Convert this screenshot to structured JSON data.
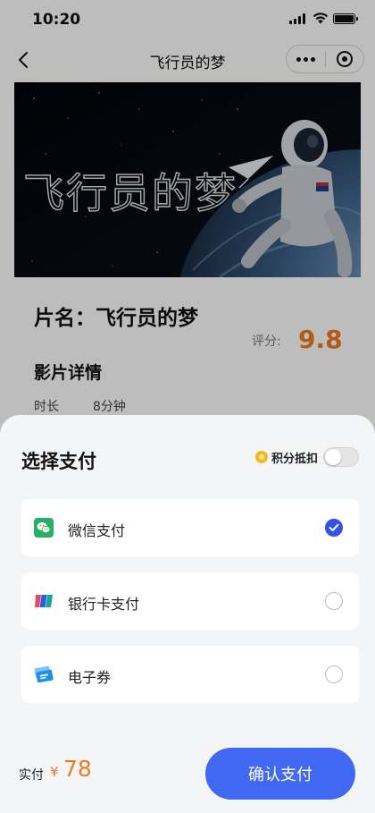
{
  "status_bar": {
    "time": "10:20"
  },
  "nav": {
    "title": "飞行员的梦"
  },
  "poster": {
    "title_art": "飞行员的梦"
  },
  "movie": {
    "name_line": "片名：飞行员的梦",
    "score_label": "评分:",
    "score": "9.8",
    "details_heading": "影片详情",
    "duration_label": "时长",
    "duration_value": "8分钟"
  },
  "payment_sheet": {
    "title": "选择支付",
    "points_label": "积分抵扣",
    "points_enabled": false,
    "options": [
      {
        "label": "微信支付",
        "icon": "wechat-pay-icon",
        "selected": true
      },
      {
        "label": "银行卡支付",
        "icon": "bank-card-icon",
        "selected": false
      },
      {
        "label": "电子券",
        "icon": "e-coupon-icon",
        "selected": false
      }
    ],
    "total_label": "实付",
    "currency": "¥",
    "amount": "78",
    "confirm_label": "确认支付"
  },
  "colors": {
    "accent_blue": "#4168f2",
    "price_orange": "#f07a1e",
    "wechat_green": "#2aae67"
  }
}
